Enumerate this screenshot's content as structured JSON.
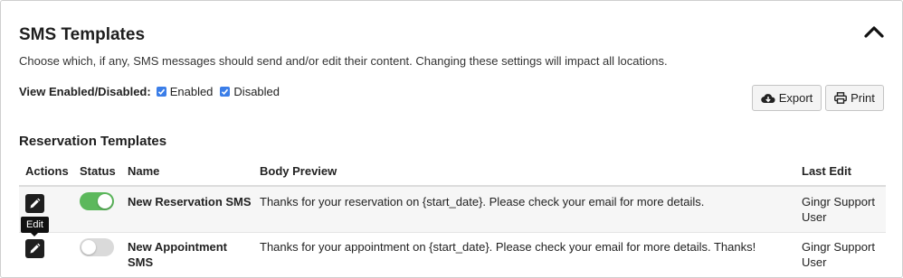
{
  "section": {
    "title": "SMS Templates",
    "description": "Choose which, if any, SMS messages should send and/or edit their content. Changing these settings will impact all locations.",
    "collapse_icon": "chevron-up-icon"
  },
  "filter": {
    "label": "View Enabled/Disabled:",
    "options": [
      {
        "label": "Enabled",
        "checked": true
      },
      {
        "label": "Disabled",
        "checked": true
      }
    ],
    "checkbox_color": "#3b7ee8"
  },
  "toolbar": {
    "export_label": "Export",
    "export_icon": "cloud-download-icon",
    "print_label": "Print",
    "print_icon": "printer-icon"
  },
  "table": {
    "title": "Reservation Templates",
    "columns": [
      "Actions",
      "Status",
      "Name",
      "Body Preview",
      "Last Edit"
    ],
    "rows": [
      {
        "status": "on",
        "name": "New Reservation SMS",
        "name_lines": [
          "New Reservation SMS"
        ],
        "body": "Thanks for your reservation on {start_date}. Please check your email for more details.",
        "last_edit": [
          "Gingr Support",
          "User"
        ]
      },
      {
        "status": "off",
        "name": "New Appointment SMS",
        "name_lines": [
          "New Appointment",
          "SMS"
        ],
        "body": "Thanks for your appointment on {start_date}. Please check your email for more details. Thanks!",
        "last_edit": [
          "Gingr Support",
          "User"
        ]
      }
    ],
    "edit_icon": "pencil-icon"
  },
  "tooltip": {
    "text": "Edit"
  },
  "colors": {
    "toggle_on": "#5cb85c",
    "toggle_off": "#dadada",
    "edit_button": "#1f1f1f"
  }
}
